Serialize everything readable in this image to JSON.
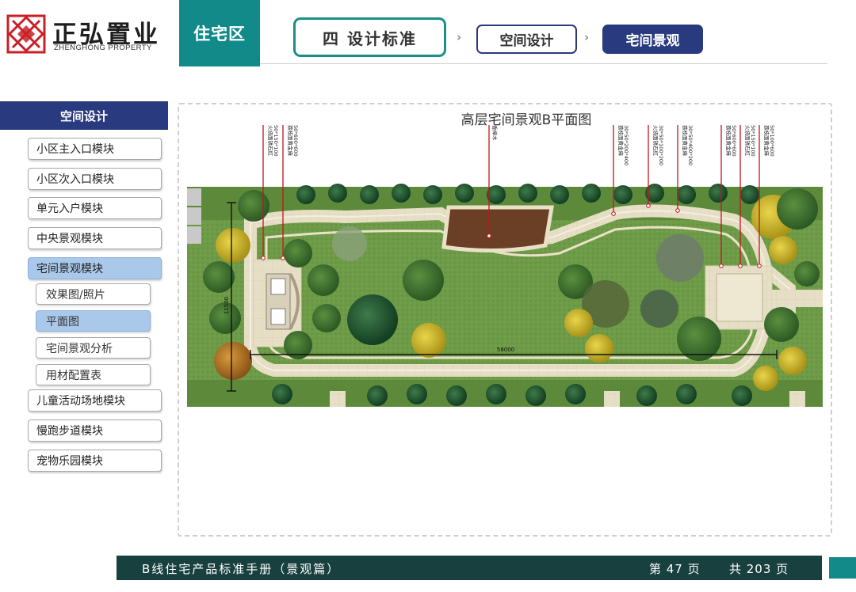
{
  "brand": {
    "name_cn": "正弘置业",
    "name_en": "ZHENGHONG PROPERTY"
  },
  "header": {
    "section_tab": "住宅区",
    "breadcrumb": [
      {
        "label": "四   设计标准",
        "arrow": "›"
      },
      {
        "label": "空间设计",
        "arrow": "›"
      },
      {
        "label": "宅间景观"
      }
    ]
  },
  "sidebar": {
    "header": "空间设计",
    "items": [
      {
        "label": "小区主入口模块"
      },
      {
        "label": "小区次入口模块"
      },
      {
        "label": "单元入户模块"
      },
      {
        "label": "中央景观模块"
      },
      {
        "label": "宅间景观模块",
        "active": true
      },
      {
        "label": "效果图/照片",
        "sub": true
      },
      {
        "label": "平面图",
        "sub": true,
        "active": true
      },
      {
        "label": "宅间景观分析",
        "sub": true
      },
      {
        "label": "用材配置表",
        "sub": true
      },
      {
        "label": "儿童活动场地模块"
      },
      {
        "label": "慢跑步道模块"
      },
      {
        "label": "宠物乐园模块"
      }
    ]
  },
  "main": {
    "plan_title": "高层宅间景观B平面图",
    "annotations": [
      {
        "lines": [
          "火烧面锈石红",
          "50*150*100"
        ]
      },
      {
        "lines": [
          "荔枝面黄金麻",
          "50*600*600"
        ]
      },
      {
        "lines": [
          "香樟木"
        ]
      },
      {
        "lines": [
          "荔枝面黄金麻",
          "30*50*200*400"
        ]
      },
      {
        "lines": [
          "火烧面锈石红",
          "30*50*100*200"
        ]
      },
      {
        "lines": [
          "荔枝面黄金麻",
          "30*50*400*200"
        ]
      },
      {
        "lines": [
          "荔枝面黄金麻",
          "50*600*600"
        ]
      },
      {
        "lines": [
          "火烧面锈石红",
          "50*150*100"
        ]
      },
      {
        "lines": [
          "荔枝面黄金麻",
          "50*100*600"
        ]
      }
    ],
    "dimension_width": "58000",
    "dimension_height": "11500"
  },
  "colors": {
    "teal": "#128a8a",
    "navy": "#2a3a7e",
    "footer_bg": "#17403f",
    "leader_red": "#c4141c",
    "lawn": "#6c9a45",
    "path": "#e6dfc6",
    "timber_deck": "#6b3f25"
  },
  "footer": {
    "title": "B线住宅产品标准手册（景观篇）",
    "page_label": "第 47 页",
    "total_label": "共 203 页"
  }
}
